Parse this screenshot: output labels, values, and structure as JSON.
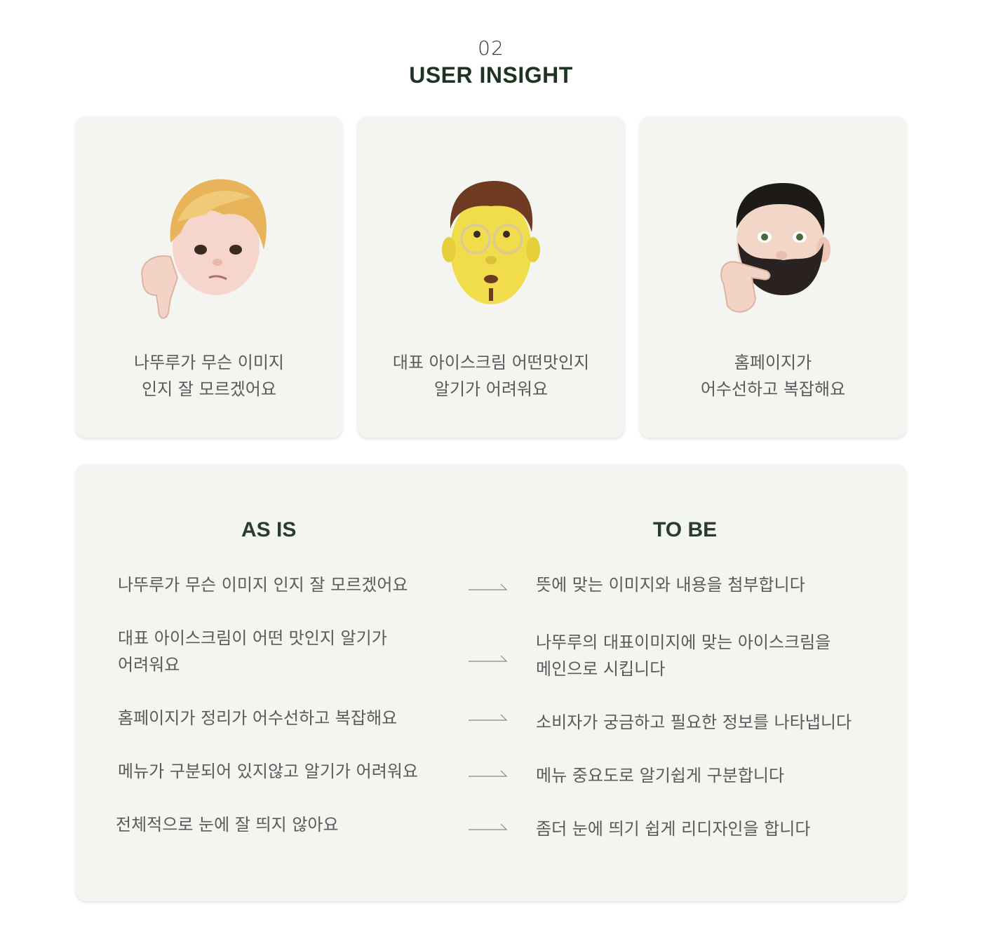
{
  "header": {
    "number": "02",
    "title": "USER INSIGHT"
  },
  "cards": [
    {
      "avatar": "thumbs-down-blonde-avatar-icon",
      "line1": "나뚜루가 무슨 이미지",
      "line2": "인지 잘 모르겠어요"
    },
    {
      "avatar": "glasses-eyeroll-avatar-icon",
      "line1": "대표 아이스크림 어떤맛인지",
      "line2": "알기가 어려워요"
    },
    {
      "avatar": "thinking-bearded-avatar-icon",
      "line1": "홈페이지가",
      "line2": "어수선하고 복잡해요"
    }
  ],
  "compare": {
    "as_is_title": "AS IS",
    "to_be_title": "TO BE",
    "rows": [
      {
        "as_is": [
          "나뚜루가 무슨 이미지 인지 잘 모르겠어요"
        ],
        "to_be": [
          "뜻에 맞는 이미지와 내용을 첨부합니다"
        ]
      },
      {
        "as_is": [
          "대표 아이스크림이 어떤 맛인지 알기가",
          "어려워요"
        ],
        "to_be": [
          "나뚜루의 대표이미지에 맞는 아이스크림을",
          "메인으로 시킵니다"
        ]
      },
      {
        "as_is": [
          "홈페이지가 정리가 어수선하고 복잡해요"
        ],
        "to_be": [
          "소비자가 궁금하고 필요한 정보를 나타냅니다"
        ]
      },
      {
        "as_is": [
          "메뉴가 구분되어 있지않고 알기가 어려워요"
        ],
        "to_be": [
          "메뉴 중요도로 알기쉽게 구분합니다"
        ]
      },
      {
        "as_is": [
          "전체적으로 눈에 잘 띄지 않아요"
        ],
        "to_be": [
          "좀더 눈에 띄기 쉽게 리디자인을 합니다"
        ]
      }
    ]
  },
  "colors": {
    "title": "#1f3322",
    "card_bg": "#f4f4f0",
    "text": "#5a5a5a"
  }
}
